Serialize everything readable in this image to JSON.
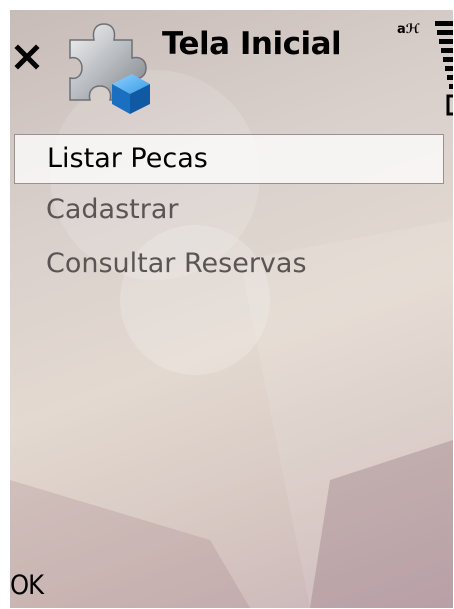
{
  "title_bar": {
    "title": "Tela Inicial",
    "close_icon": "close-icon",
    "app_icon": "puzzle-piece-icon",
    "status_icon": "signal-strength-icon"
  },
  "menu": {
    "items": [
      {
        "label": "Listar Pecas",
        "selected": true
      },
      {
        "label": "Cadastrar",
        "selected": false
      },
      {
        "label": "Consultar Reservas",
        "selected": false
      }
    ]
  },
  "softkeys": {
    "left": "OK"
  },
  "colors": {
    "text_primary": "#000000",
    "text_secondary": "#5a5454",
    "selection_bg": "#f4f0ef",
    "accent_blue": "#1a7fd4"
  }
}
